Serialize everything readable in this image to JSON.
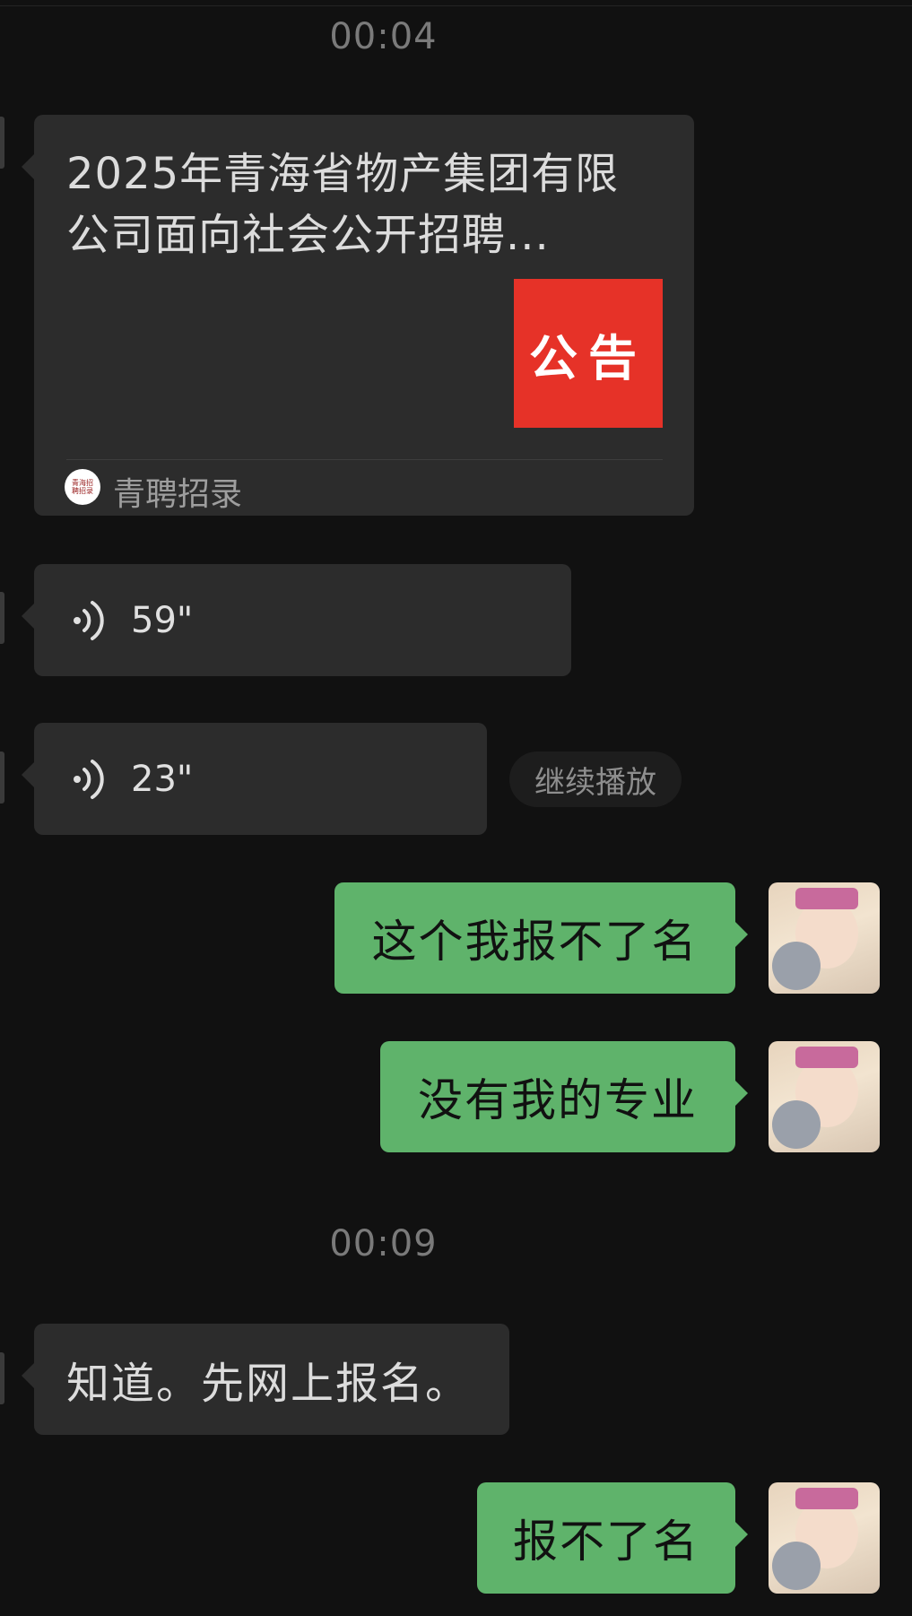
{
  "chat": {
    "timestamps": [
      "00:04",
      "00:09"
    ],
    "article": {
      "title": "2025年青海省物产集团有限公司面向社会公开招聘...",
      "thumb_text": "公告",
      "source_name": "青聘招录",
      "source_logo_text": "青海招聘招录"
    },
    "voice_messages": [
      {
        "duration": "59\""
      },
      {
        "duration": "23\""
      }
    ],
    "continue_label": "继续播放",
    "messages": [
      {
        "side": "right",
        "text": "这个我报不了名"
      },
      {
        "side": "right",
        "text": "没有我的专业"
      },
      {
        "side": "left",
        "text": "知道。先网上报名。"
      },
      {
        "side": "right",
        "text": "报不了名"
      }
    ]
  },
  "colors": {
    "background": "#111111",
    "incoming_bubble": "#2c2c2c",
    "outgoing_bubble": "#5fb36b",
    "announcement_red": "#e63228"
  },
  "icons": [
    "voice-wave-icon",
    "avatar-image",
    "source-logo-icon"
  ]
}
